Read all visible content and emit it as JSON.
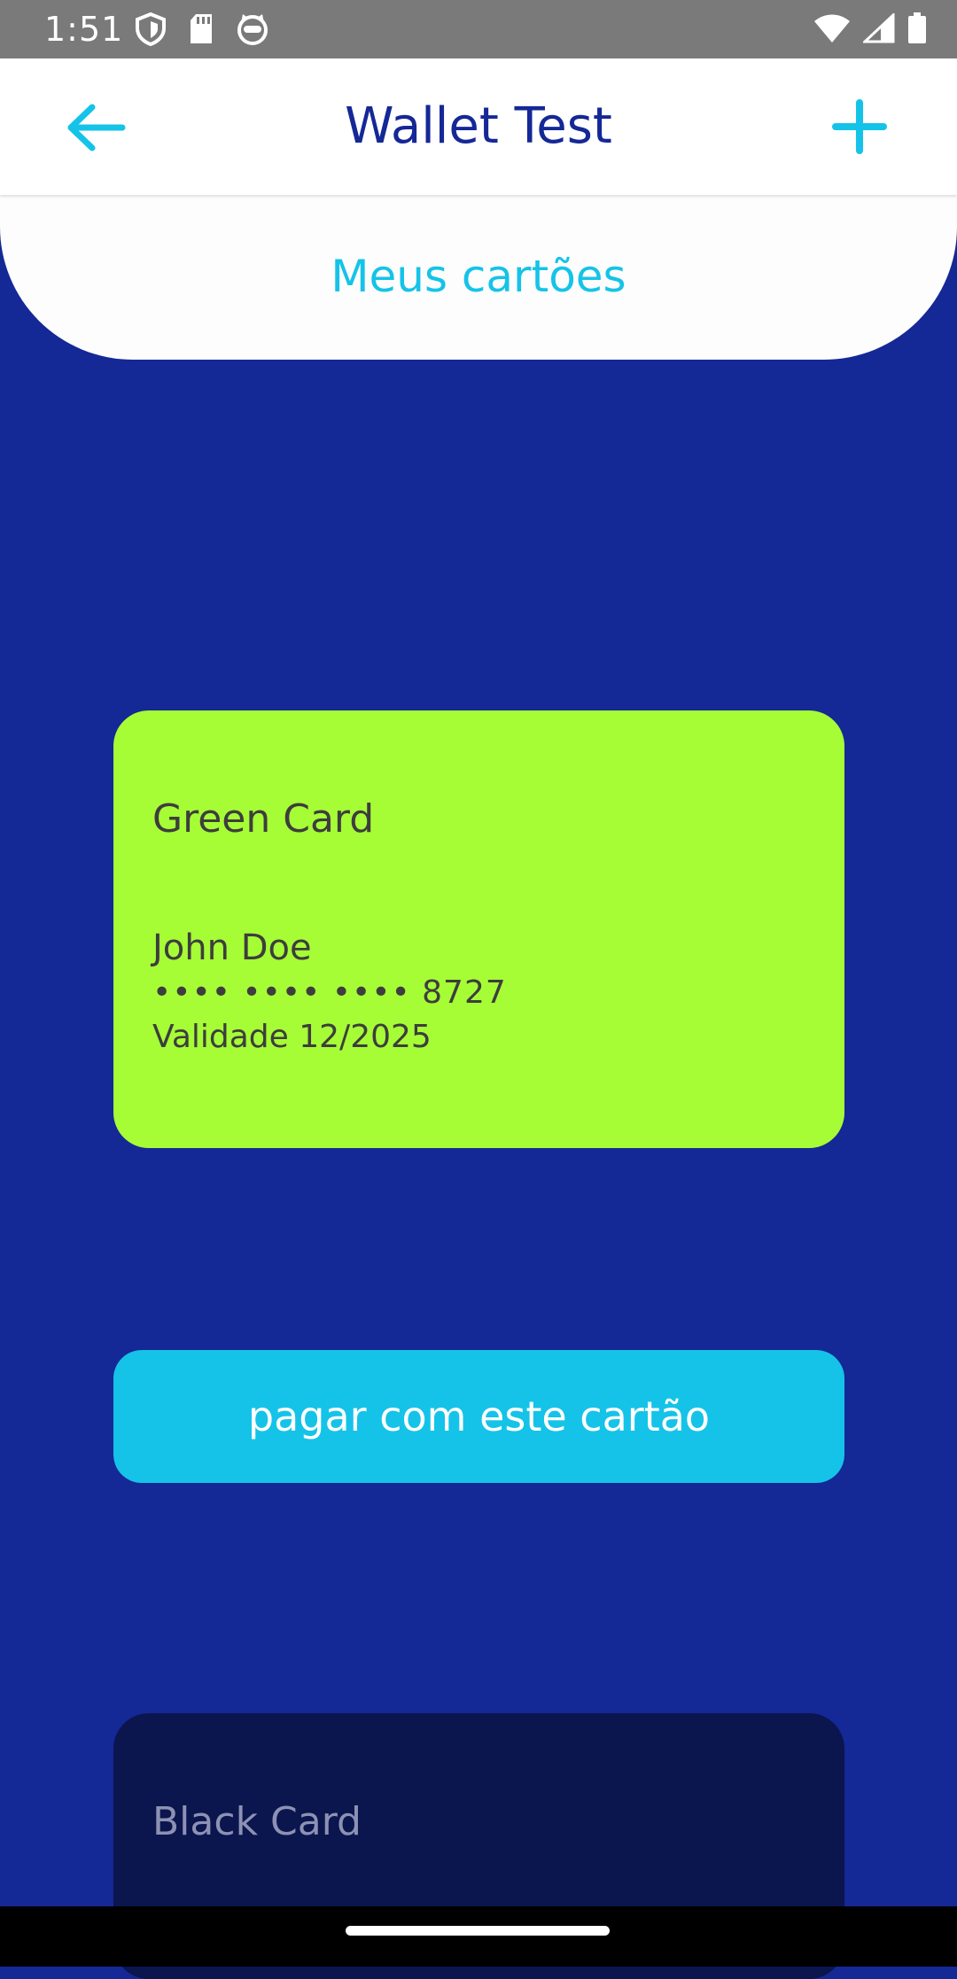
{
  "status_bar": {
    "time": "1:51",
    "left_icons": [
      "shield-icon",
      "sd-card-icon",
      "cat-face-icon"
    ],
    "right_icons": [
      "wifi-icon",
      "cell-signal-icon",
      "battery-icon"
    ]
  },
  "app_bar": {
    "title": "Wallet Test",
    "back_icon": "arrow-left-icon",
    "add_icon": "plus-icon",
    "accent_color": "#15c3e8",
    "title_color": "#142896"
  },
  "section": {
    "title": "Meus cartões"
  },
  "cards": [
    {
      "name": "Green Card",
      "holder": "John Doe",
      "number": "•••• •••• •••• 8727",
      "expiry": "Validade 12/2025",
      "color": "#a6fd36"
    },
    {
      "name": "Black Card",
      "color": "#0b154e"
    }
  ],
  "pay_button": {
    "label": "pagar com este cartão",
    "color": "#15c3e8"
  },
  "background_color": "#142896"
}
